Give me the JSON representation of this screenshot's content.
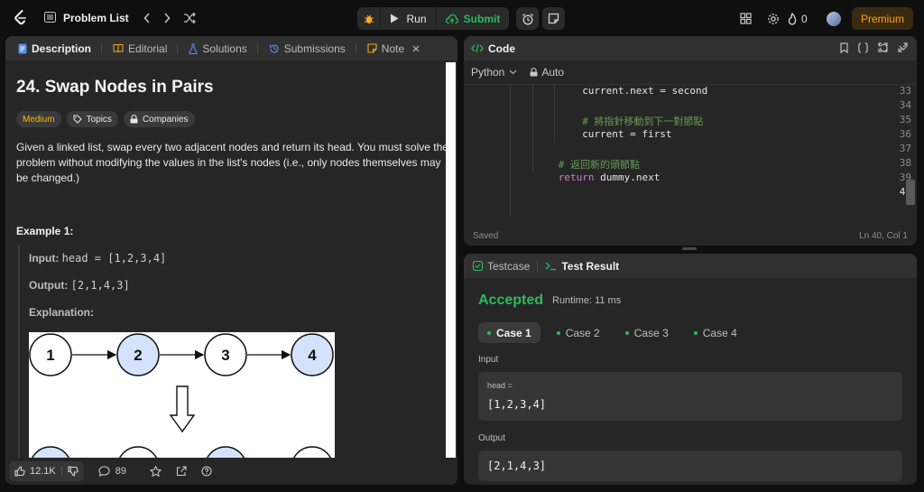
{
  "topbar": {
    "problem_list": "Problem List",
    "run": "Run",
    "submit": "Submit",
    "streak": "0",
    "premium": "Premium"
  },
  "left": {
    "tabs": [
      "Description",
      "Editorial",
      "Solutions",
      "Submissions",
      "Note"
    ],
    "title": "24. Swap Nodes in Pairs",
    "chips": [
      "Medium",
      "Topics",
      "Companies"
    ],
    "description": "Given a linked list, swap every two adjacent nodes and return its head. You must solve the problem without modifying the values in the list's nodes (i.e., only nodes themselves may be changed.)",
    "example_title": "Example 1:",
    "input_label": "Input:",
    "input_value": "head = [1,2,3,4]",
    "output_label": "Output:",
    "output_value": "[2,1,4,3]",
    "explanation_label": "Explanation:",
    "diagram_nodes": [
      "1",
      "2",
      "3",
      "4"
    ],
    "likes": "12.1K",
    "comments": "89"
  },
  "code": {
    "title": "Code",
    "language": "Python",
    "mode": "Auto",
    "lines": [
      {
        "n": "33",
        "indent": 12,
        "text": "current.next = second",
        "type": "code"
      },
      {
        "n": "34",
        "indent": 0,
        "text": "",
        "type": "code"
      },
      {
        "n": "35",
        "indent": 12,
        "text": "# 將指針移動到下一對節點",
        "type": "comment"
      },
      {
        "n": "36",
        "indent": 12,
        "text": "current = first",
        "type": "code"
      },
      {
        "n": "37",
        "indent": 0,
        "text": "",
        "type": "code"
      },
      {
        "n": "38",
        "indent": 8,
        "text": "# 返回新的頭節點",
        "type": "comment"
      },
      {
        "n": "39",
        "indent": 8,
        "kw": "return",
        "text": " dummy.next",
        "type": "return"
      },
      {
        "n": "40",
        "indent": 0,
        "text": "",
        "type": "code"
      }
    ],
    "saved": "Saved",
    "position": "Ln 40, Col 1"
  },
  "test": {
    "tabs": [
      "Testcase",
      "Test Result"
    ],
    "status": "Accepted",
    "runtime": "Runtime: 11 ms",
    "cases": [
      "Case 1",
      "Case 2",
      "Case 3",
      "Case 4"
    ],
    "input_label": "Input",
    "input_key": "head =",
    "input_value": "[1,2,3,4]",
    "output_label": "Output",
    "output_value": "[2,1,4,3]"
  },
  "colors": {
    "accent_green": "#2cbb5d",
    "accent_orange": "#ffa116",
    "medium_yellow": "#ffb800",
    "node_blue": "#d4e3fb"
  }
}
